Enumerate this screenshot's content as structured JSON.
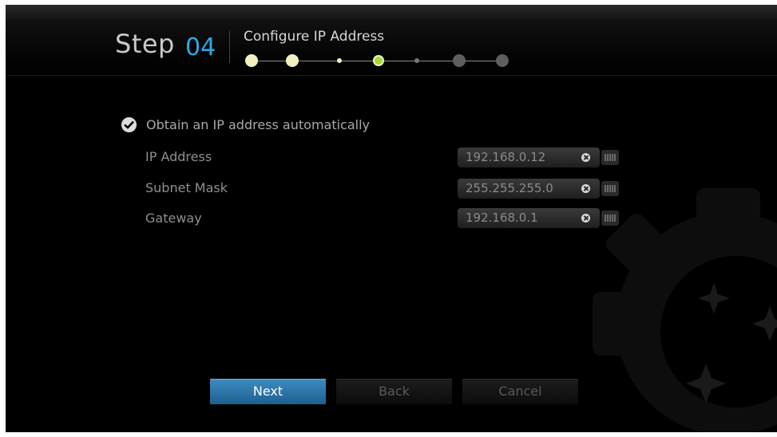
{
  "header": {
    "step_word": "Step",
    "step_number": "04",
    "title": "Configure IP Address",
    "progress": {
      "total_steps": 7,
      "current_step": 4
    }
  },
  "form": {
    "auto_ip": {
      "label": "Obtain an IP address automatically",
      "checked": true
    },
    "fields": [
      {
        "label": "IP Address",
        "value": "192.168.0.12"
      },
      {
        "label": "Subnet Mask",
        "value": "255.255.255.0"
      },
      {
        "label": "Gateway",
        "value": "192.168.0.1"
      }
    ]
  },
  "buttons": {
    "next": "Next",
    "back": "Back",
    "cancel": "Cancel"
  },
  "colors": {
    "accent": "#2ea8e6",
    "active_step": "#a8d83a",
    "done_step": "#f2f0c0",
    "next_button": "#2a72a6"
  }
}
